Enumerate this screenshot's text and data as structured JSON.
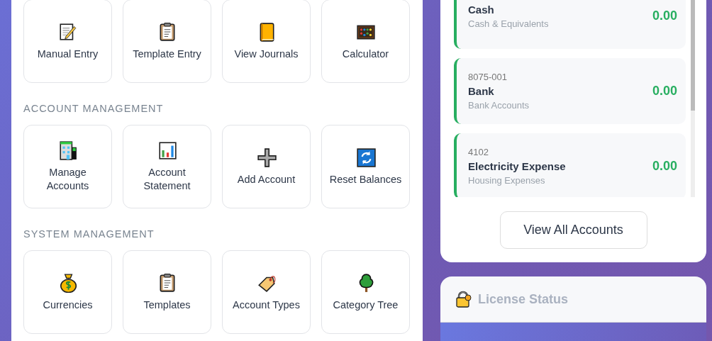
{
  "sections": [
    {
      "tiles": [
        {
          "label": "Manual Entry"
        },
        {
          "label": "Template Entry"
        },
        {
          "label": "View Journals"
        },
        {
          "label": "Calculator"
        }
      ]
    },
    {
      "title": "ACCOUNT MANAGEMENT",
      "tiles": [
        {
          "label": "Manage Accounts"
        },
        {
          "label": "Account Statement"
        },
        {
          "label": "Add Account"
        },
        {
          "label": "Reset Balances"
        }
      ]
    },
    {
      "title": "SYSTEM MANAGEMENT",
      "tiles": [
        {
          "label": "Currencies"
        },
        {
          "label": "Templates"
        },
        {
          "label": "Account Types"
        },
        {
          "label": "Category Tree"
        }
      ]
    }
  ],
  "accounts": [
    {
      "name": "Cash",
      "type": "Cash & Equivalents",
      "balance": "0.00"
    },
    {
      "code": "8075-001",
      "name": "Bank",
      "type": "Bank Accounts",
      "balance": "0.00"
    },
    {
      "code": "4102",
      "name": "Electricity Expense",
      "type": "Housing Expenses",
      "balance": "0.00"
    }
  ],
  "view_all_button": "View All Accounts",
  "license": {
    "title": "License Status"
  }
}
